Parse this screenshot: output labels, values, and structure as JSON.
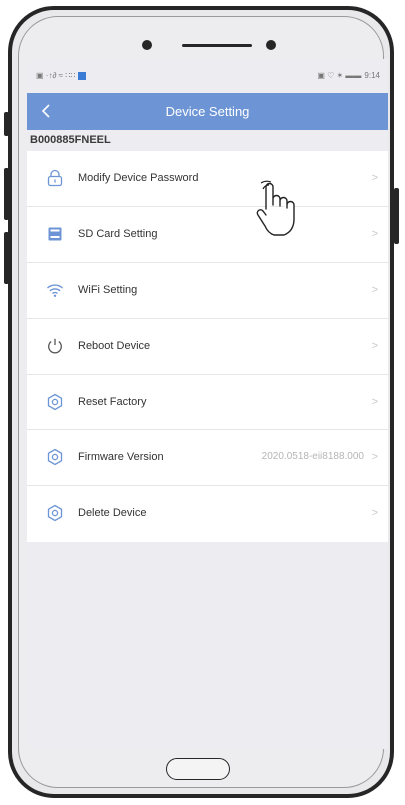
{
  "status_bar": {
    "left_glyphs": "▣ ·↑∂ ≈ ∷∷",
    "right_glyphs": "▣ ♡ ✶ ▬▬",
    "time": "9:14"
  },
  "nav": {
    "back_label": "<",
    "title": "Device Setting"
  },
  "device": {
    "id": "B000885FNEEL"
  },
  "menu": {
    "items": [
      {
        "label": "Modify Device Password",
        "value": "",
        "icon": "lock-icon"
      },
      {
        "label": "SD Card Setting",
        "value": "",
        "icon": "sd-card-icon"
      },
      {
        "label": "WiFi Setting",
        "value": "",
        "icon": "wifi-icon"
      },
      {
        "label": "Reboot Device",
        "value": "",
        "icon": "power-icon"
      },
      {
        "label": "Reset Factory",
        "value": "",
        "icon": "gear-icon"
      },
      {
        "label": "Firmware Version",
        "value": "2020.0518-eii8188.000",
        "icon": "gear-icon"
      },
      {
        "label": "Delete Device",
        "value": "",
        "icon": "gear-icon"
      }
    ],
    "chevron": ">"
  },
  "colors": {
    "nav_bar": "#6d95d6",
    "icon_blue": "#6d95d6",
    "screen_bg": "#ececf1"
  }
}
